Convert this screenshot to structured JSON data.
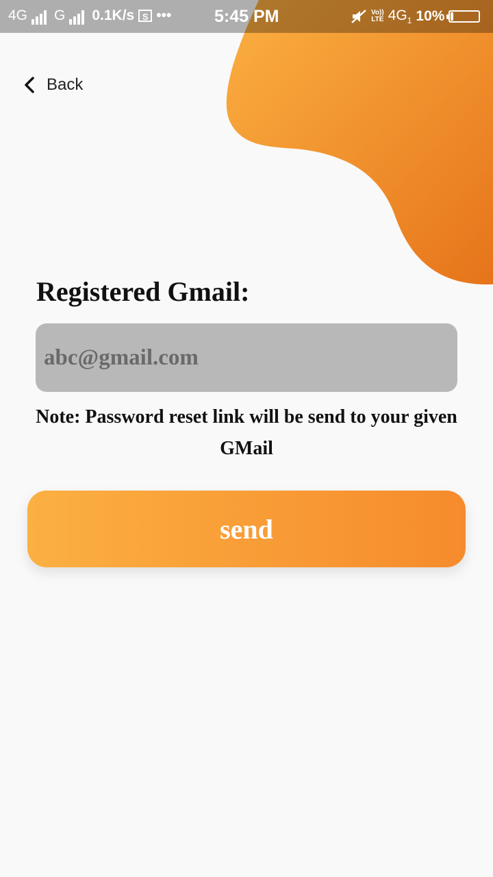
{
  "status_bar": {
    "network1": "4G",
    "network2": "G",
    "speed": "0.1K/s",
    "screenshot_glyph": "S",
    "more": "•••",
    "time": "5:45 PM",
    "volte_top": "Vo))",
    "volte_bottom": "LTE",
    "network3": "4G",
    "network3_sub": "1",
    "battery": "10%",
    "battery_level": 0.1
  },
  "header": {
    "back_label": "Back"
  },
  "form": {
    "email_label": "Registered Gmail:",
    "email_placeholder": "abc@gmail.com",
    "email_value": "",
    "note": "Note: Password reset link will be send to your given GMail",
    "send_label": "send"
  },
  "colors": {
    "accent_start": "#fbb042",
    "accent_end": "#f68b2c",
    "blob_dark": "#e6741a",
    "input_bg": "#b8b8b8",
    "page_bg": "#f9f9f9"
  }
}
